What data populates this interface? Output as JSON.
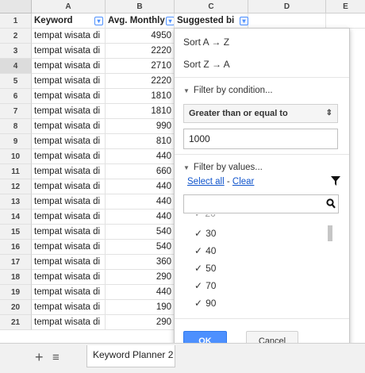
{
  "columns": {
    "a": "A",
    "b": "B",
    "c": "C",
    "d": "D",
    "e": "E"
  },
  "header_row": {
    "number": "1",
    "keyword": "Keyword",
    "avg_monthly": "Avg. Monthly",
    "suggested_bid": "Suggested bi"
  },
  "rows": [
    {
      "n": "2",
      "keyword": "tempat wisata di",
      "value": "4950"
    },
    {
      "n": "3",
      "keyword": "tempat wisata di",
      "value": "2220"
    },
    {
      "n": "4",
      "keyword": "tempat wisata di",
      "value": "2710"
    },
    {
      "n": "5",
      "keyword": "tempat wisata di",
      "value": "2220"
    },
    {
      "n": "6",
      "keyword": "tempat wisata di",
      "value": "1810"
    },
    {
      "n": "7",
      "keyword": "tempat wisata di",
      "value": "1810"
    },
    {
      "n": "8",
      "keyword": "tempat wisata di",
      "value": "990"
    },
    {
      "n": "9",
      "keyword": "tempat wisata di",
      "value": "810"
    },
    {
      "n": "10",
      "keyword": "tempat wisata di",
      "value": "440"
    },
    {
      "n": "11",
      "keyword": "tempat wisata di",
      "value": "660"
    },
    {
      "n": "12",
      "keyword": "tempat wisata di",
      "value": "440"
    },
    {
      "n": "13",
      "keyword": "tempat wisata di",
      "value": "440"
    },
    {
      "n": "14",
      "keyword": "tempat wisata di",
      "value": "440"
    },
    {
      "n": "15",
      "keyword": "tempat wisata di",
      "value": "540"
    },
    {
      "n": "16",
      "keyword": "tempat wisata di",
      "value": "540"
    },
    {
      "n": "17",
      "keyword": "tempat wisata di",
      "value": "360"
    },
    {
      "n": "18",
      "keyword": "tempat wisata di",
      "value": "290"
    },
    {
      "n": "19",
      "keyword": "tempat wisata di",
      "value": "440"
    },
    {
      "n": "20",
      "keyword": "tempat wisata di",
      "value": "190"
    },
    {
      "n": "21",
      "keyword": "tempat wisata di",
      "value": "290"
    }
  ],
  "filter_menu": {
    "sort_asc": "Sort A → Z",
    "sort_desc": "Sort Z → A",
    "filter_by_condition": "Filter by condition...",
    "condition_selected": "Greater than or equal to",
    "condition_value": "1000",
    "filter_by_values": "Filter by values...",
    "select_all": "Select all",
    "link_sep": " - ",
    "clear": "Clear",
    "search_value": "",
    "values": [
      {
        "check": "✓",
        "label": "30"
      },
      {
        "check": "✓",
        "label": "40"
      },
      {
        "check": "✓",
        "label": "50"
      },
      {
        "check": "✓",
        "label": "70"
      },
      {
        "check": "✓",
        "label": "90"
      }
    ],
    "ok_label": "OK",
    "cancel_label": "Cancel"
  },
  "bottom": {
    "add_sheet": "+",
    "sheet_list": "≡",
    "sheet_tab": "Keyword Planner 2"
  },
  "colors": {
    "accent": "#4d90fe",
    "link": "#1155cc",
    "header_bg": "#f1f1f1"
  }
}
